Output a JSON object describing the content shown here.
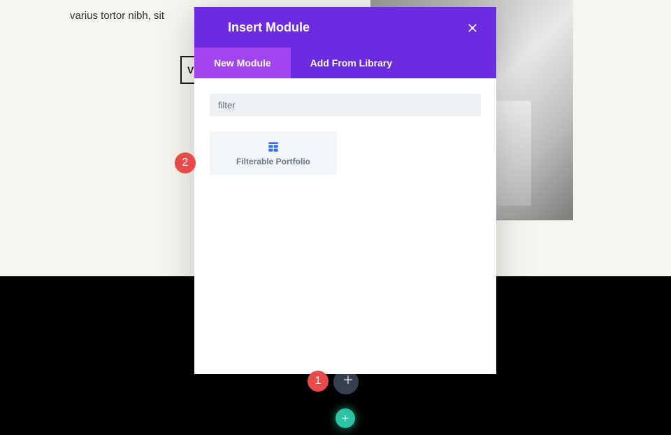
{
  "background": {
    "text_fragment": "varius tortor nibh, sit",
    "button_label": "V"
  },
  "modal": {
    "title": "Insert Module",
    "tabs": [
      {
        "label": "New Module",
        "active": true
      },
      {
        "label": "Add From Library",
        "active": false
      }
    ],
    "search_value": "filter",
    "modules": [
      {
        "label": "Filterable Portfolio",
        "icon": "grid-icon"
      }
    ]
  },
  "markers": {
    "one": "1",
    "two": "2"
  },
  "colors": {
    "modal_header": "#6b2be0",
    "tab_active": "#a244ef",
    "marker": "#e94b4b",
    "plus_teal": "#2bc4a5",
    "module_icon": "#2f6ef2"
  }
}
